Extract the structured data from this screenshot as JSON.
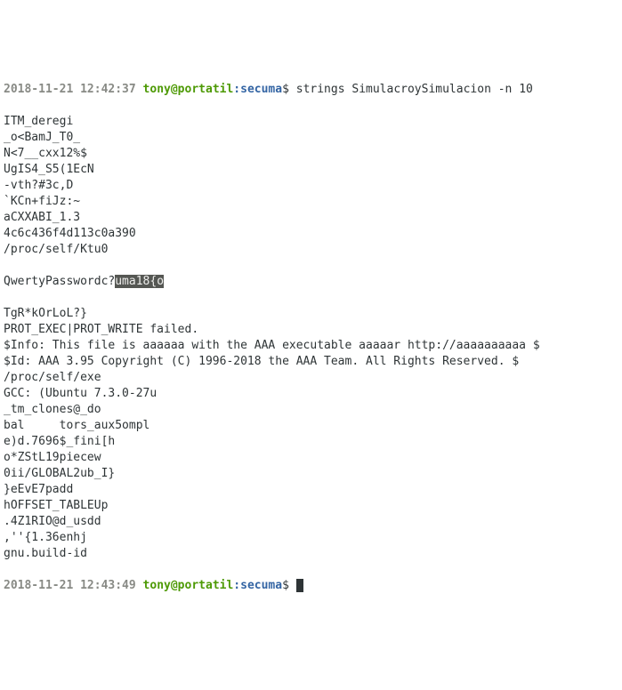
{
  "prompt1": {
    "timestamp": "2018-11-21 12:42:37",
    "userhost": "tony@portatil",
    "sep": ":",
    "path": "secuma",
    "dollar": "$ ",
    "command": "strings SimulacroySimulacion -n 10"
  },
  "output_lines": [
    "ITM_deregi",
    "_o<BamJ_T0_",
    "N<7__cxx12%$",
    "UgIS4_S5(1EcN",
    "-vth?#3c,D",
    "`KCn+fiJz:~",
    "aCXXABI_1.3",
    "4c6c436f4d113c0a390",
    "/proc/self/Ktu0"
  ],
  "highlight_line": {
    "before": "QwertyPasswordc?",
    "highlight": "uma18{o"
  },
  "output_lines_after": [
    "TgR*kOrLoL?}",
    "PROT_EXEC|PROT_WRITE failed.",
    "$Info: This file is aaaaaa with the AAA executable aaaaar http://aaaaaaaaaa $",
    "$Id: AAA 3.95 Copyright (C) 1996-2018 the AAA Team. All Rights Reserved. $",
    "/proc/self/exe",
    "GCC: (Ubuntu 7.3.0-27u",
    "_tm_clones@_do",
    "bal     tors_aux5ompl",
    "e)d.7696$_fini[h",
    "o*ZStL19piecew",
    "0ii/GLOBAL2ub_I}",
    "}eEvE7padd",
    "hOFFSET_TABLEUp",
    ".4Z1RIO@d_usdd",
    ",''{1.36enhj",
    "gnu.build-id"
  ],
  "prompt2": {
    "timestamp": "2018-11-21 12:43:49",
    "userhost": "tony@portatil",
    "sep": ":",
    "path": "secuma",
    "dollar": "$ "
  }
}
